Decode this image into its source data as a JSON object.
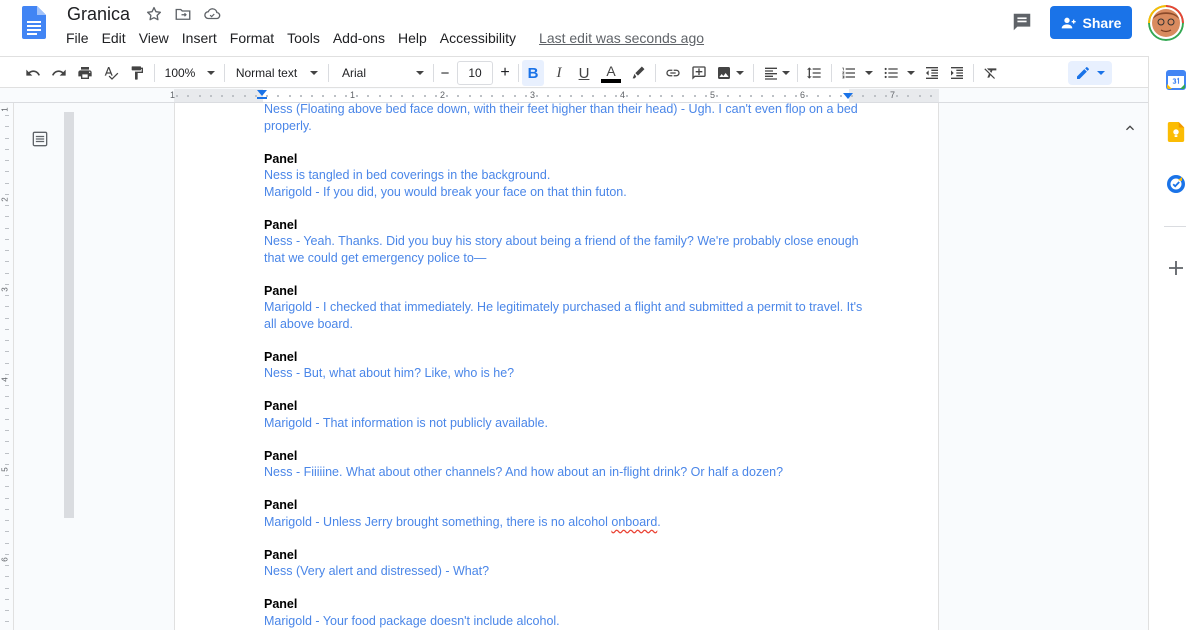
{
  "app": {
    "title": "Granica",
    "last_edit": "Last edit was seconds ago",
    "share_label": "Share"
  },
  "menu": [
    "File",
    "Edit",
    "View",
    "Insert",
    "Format",
    "Tools",
    "Add-ons",
    "Help",
    "Accessibility"
  ],
  "toolbar": {
    "zoom": "100%",
    "style": "Normal text",
    "font": "Arial",
    "font_size": "10",
    "minus": "−",
    "plus": "+",
    "bold": "B",
    "italic": "I",
    "underline": "U",
    "text_color": "A"
  },
  "ruler": {
    "h_numbers": [
      "1",
      "1",
      "2",
      "3",
      "4",
      "5",
      "6",
      "7"
    ],
    "v_numbers": [
      "1",
      "2",
      "3",
      "4",
      "5",
      "6"
    ]
  },
  "document": {
    "blocks": [
      {
        "heading": "",
        "lines": [
          "Ness (Floating above bed face down, with their feet higher than their head) - Ugh. I can't even flop on a bed properly."
        ]
      },
      {
        "heading": "Panel",
        "lines": [
          "Ness is tangled in bed coverings in the background.",
          "Marigold - If you did, you would break your face on that thin futon."
        ]
      },
      {
        "heading": "Panel",
        "lines": [
          "Ness - Yeah. Thanks. Did you buy his story about being a friend of the family? We're probably close enough that we could get emergency police to—"
        ]
      },
      {
        "heading": "Panel",
        "lines": [
          "Marigold - I checked that immediately. He legitimately purchased a flight and submitted a permit to travel. It's all above board."
        ]
      },
      {
        "heading": "Panel",
        "lines": [
          "Ness - But, what about him? Like, who is he?"
        ]
      },
      {
        "heading": "Panel",
        "lines": [
          "Marigold - That information is not publicly available."
        ]
      },
      {
        "heading": "Panel",
        "lines": [
          "Ness - Fiiiiine. What about other channels? And how about an in-flight drink? Or half a dozen?"
        ]
      },
      {
        "heading": "Panel",
        "lines": [
          "Marigold - Unless Jerry brought something, there is no alcohol ",
          "onboard",
          "."
        ]
      },
      {
        "heading": "Panel",
        "lines": [
          "Ness (Very alert and distressed) - What?"
        ]
      },
      {
        "heading": "Panel",
        "lines": [
          "Marigold - Your food package doesn't include alcohol."
        ]
      }
    ]
  },
  "colors": {
    "accent": "#1a73e8",
    "text_blue": "#4a86e8",
    "docs_blue": "#4285f4"
  },
  "icons": {
    "docs_logo": "docs-logo-icon",
    "star": "star-icon",
    "move": "folder-move-icon",
    "cloud": "cloud-saved-icon",
    "comment": "comment-icon",
    "share": "person-add-icon",
    "calendar": "calendar-icon",
    "keep": "keep-icon",
    "tasks": "tasks-icon",
    "add": "plus-icon"
  }
}
